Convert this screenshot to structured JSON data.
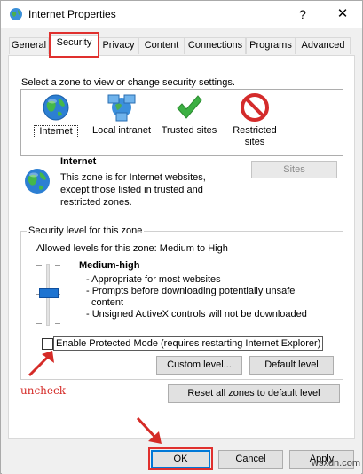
{
  "window": {
    "title": "Internet Properties",
    "help_glyph": "?",
    "close_glyph": "✕"
  },
  "tabs": [
    {
      "label": "General"
    },
    {
      "label": "Security"
    },
    {
      "label": "Privacy"
    },
    {
      "label": "Content"
    },
    {
      "label": "Connections"
    },
    {
      "label": "Programs"
    },
    {
      "label": "Advanced"
    }
  ],
  "zones": {
    "caption": "Select a zone to view or change security settings.",
    "items": [
      {
        "label": "Internet",
        "icon": "globe-icon",
        "selected": true
      },
      {
        "label": "Local intranet",
        "icon": "network-icon"
      },
      {
        "label": "Trusted sites",
        "icon": "checkmark-icon"
      },
      {
        "label": "Restricted sites",
        "label_line1": "Restricted",
        "label_line2": "sites",
        "icon": "no-entry-icon"
      }
    ]
  },
  "zone_info": {
    "title": "Internet",
    "desc_line1": "This zone is for Internet websites,",
    "desc_line2": "except those listed in trusted and",
    "desc_line3": "restricted zones.",
    "sites_button": "Sites"
  },
  "security_level": {
    "group_title": "Security level for this zone",
    "allowed": "Allowed levels for this zone: Medium to High",
    "level_name": "Medium-high",
    "bullets": [
      "- Appropriate for most websites",
      "- Prompts before downloading potentially unsafe",
      "content",
      "- Unsigned ActiveX controls will not be downloaded"
    ],
    "slider_level": "Medium-high"
  },
  "protected_mode": {
    "label": "Enable Protected Mode (requires restarting Internet Explorer)",
    "checked": false
  },
  "buttons": {
    "custom_level": "Custom level...",
    "default_level": "Default level",
    "reset_all": "Reset all zones to default level",
    "ok": "OK",
    "cancel": "Cancel",
    "apply": "Apply"
  },
  "annotation": {
    "uncheck_text": "uncheck",
    "color": "#d52b27"
  },
  "watermark": "wsxdn.com",
  "colors": {
    "accent": "#0078d7",
    "highlight_red": "#e0302e"
  }
}
